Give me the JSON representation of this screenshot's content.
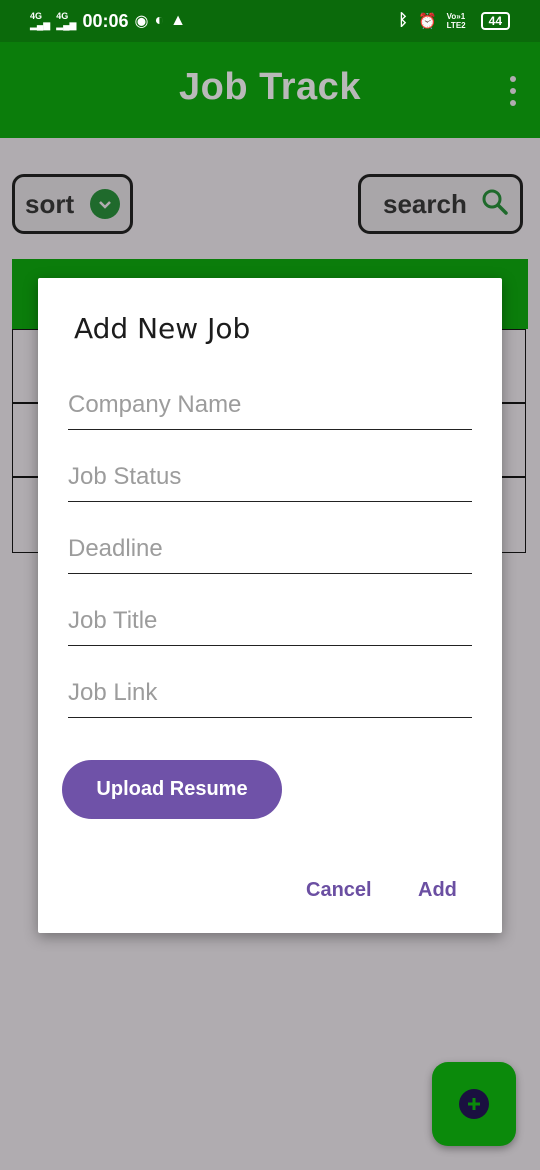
{
  "status_bar": {
    "network1": "4G",
    "network2": "4G",
    "time": "00:06",
    "volte": "Vo»1 LTE2",
    "battery": "44"
  },
  "app_bar": {
    "title": "Job Track",
    "menu_icon": "more-vert-icon"
  },
  "toolbar": {
    "sort_label": "sort",
    "sort_icon": "chevron-down-icon",
    "search_label": "search",
    "search_icon": "search-icon"
  },
  "dialog": {
    "title": "Add New Job",
    "fields": [
      {
        "placeholder": "Company Name",
        "value": ""
      },
      {
        "placeholder": "Job Status",
        "value": ""
      },
      {
        "placeholder": "Deadline",
        "value": ""
      },
      {
        "placeholder": "Job Title",
        "value": ""
      },
      {
        "placeholder": "Job Link",
        "value": ""
      }
    ],
    "upload_label": "Upload Resume",
    "cancel_label": "Cancel",
    "add_label": "Add"
  },
  "fab": {
    "icon": "add-circle-icon"
  },
  "colors": {
    "primary_green": "#0b7d0b",
    "status_green": "#0b6a0b",
    "accent_purple": "#6f52a8",
    "scrim": "#b0acb0"
  }
}
